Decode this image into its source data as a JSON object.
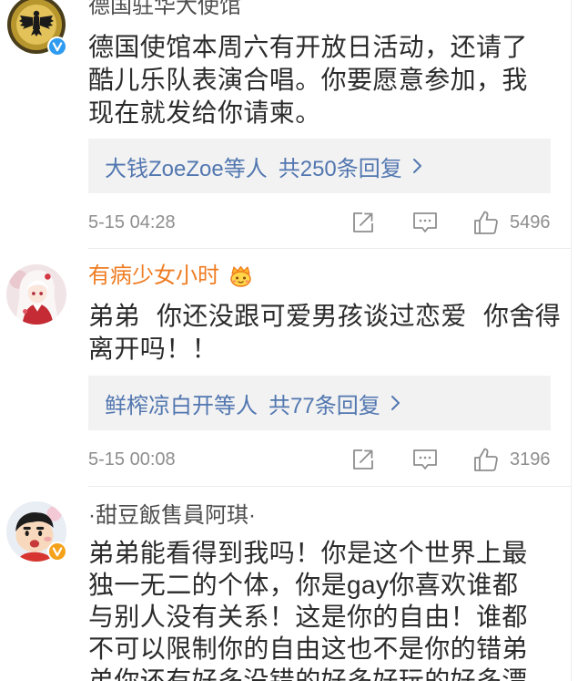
{
  "colors": {
    "text": "#2b2b2b",
    "username": "#4d4d4d",
    "username_member": "#ef7c22",
    "reply_link": "#5277b0",
    "reply_bg": "#f2f2f2",
    "meta": "#8e8e8e",
    "divider": "#ebebeb",
    "verified_blue": "#2e9bf0",
    "verified_yellow": "#f5a21b"
  },
  "icons": [
    "forward-icon",
    "comment-icon",
    "like-icon",
    "chevron-right-icon",
    "verified-badge-icon",
    "member-badge-icon"
  ],
  "comments": [
    {
      "username": "德国驻华大使馆",
      "avatar_icon": "embassy-eagle-avatar",
      "badge_icon": "verified-badge-icon",
      "body_lines": [
        "德国使馆本周六有开放日活动，还请了",
        "酷儿乐队表演合唱。你要愿意参加，我",
        "现在就发给你请柬。"
      ],
      "replies": {
        "users": "大钱ZoeZoe等人",
        "count": "共250条回复"
      },
      "timestamp": "5-15 04:28",
      "likes": "5496"
    },
    {
      "username": "有病少女小时",
      "avatar_icon": "anime-girl-avatar",
      "badge_icon": "member-badge-icon",
      "body_lines": [
        "弟弟 你还没跟可爱男孩谈过恋爱 你舍得",
        "离开吗！！"
      ],
      "replies": {
        "users": "鲜榨凉白开等人",
        "count": "共77条回复"
      },
      "timestamp": "5-15 00:08",
      "likes": "3196"
    },
    {
      "username": "·甜豆飯售員阿琪·",
      "avatar_icon": "cartoon-boy-avatar",
      "badge_icon": "verified-badge-icon",
      "body_lines": [
        "弟弟能看得到我吗！你是这个世界上最",
        "独一无二的个体，你是gay你喜欢谁都",
        "与别人没有关系！这是你的自由！谁都",
        "不可以限制你的自由这也不是你的错弟",
        "弟你还有好多没错的好多好玩的好多漂"
      ]
    }
  ]
}
